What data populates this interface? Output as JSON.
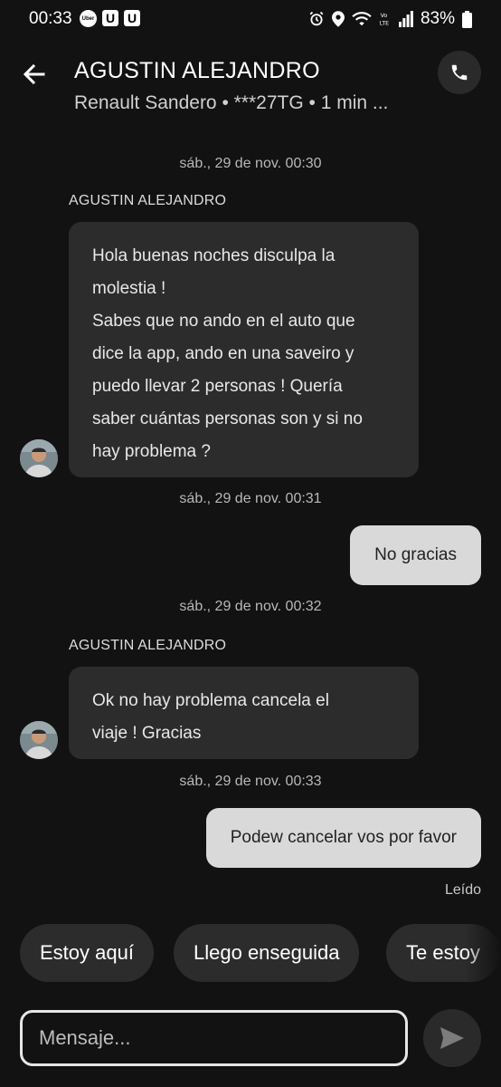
{
  "status_bar": {
    "time": "00:33",
    "app_icons": [
      "Uber",
      "U",
      "U"
    ],
    "battery": "83%"
  },
  "header": {
    "title": "AGUSTIN ALEJANDRO",
    "subtitle": "Renault Sandero • ***27TG • 1 min ..."
  },
  "messages": [
    {
      "timestamp": "sáb., 29 de nov. 00:30",
      "sender": "AGUSTIN ALEJANDRO",
      "lines": [
        "Hola buenas noches disculpa la",
        "molestia !",
        "Sabes que no ando en el auto que",
        "dice la app, ando en una saveiro y",
        "puedo llevar 2 personas ! Quería",
        "saber cuántas personas son y si no",
        "hay problema ?"
      ]
    },
    {
      "timestamp": "sáb., 29 de nov. 00:31",
      "text": "No gracias"
    },
    {
      "timestamp": "sáb., 29 de nov. 00:32",
      "sender": "AGUSTIN ALEJANDRO",
      "lines": [
        "Ok no hay problema cancela el",
        "viaje ! Gracias"
      ]
    },
    {
      "timestamp": "sáb., 29 de nov. 00:33",
      "text": "Podew cancelar vos por favor"
    }
  ],
  "read_status": "Leído",
  "quick_replies": [
    "Estoy aquí",
    "Llego enseguida",
    "Te estoy"
  ],
  "input": {
    "placeholder": "Mensaje..."
  }
}
